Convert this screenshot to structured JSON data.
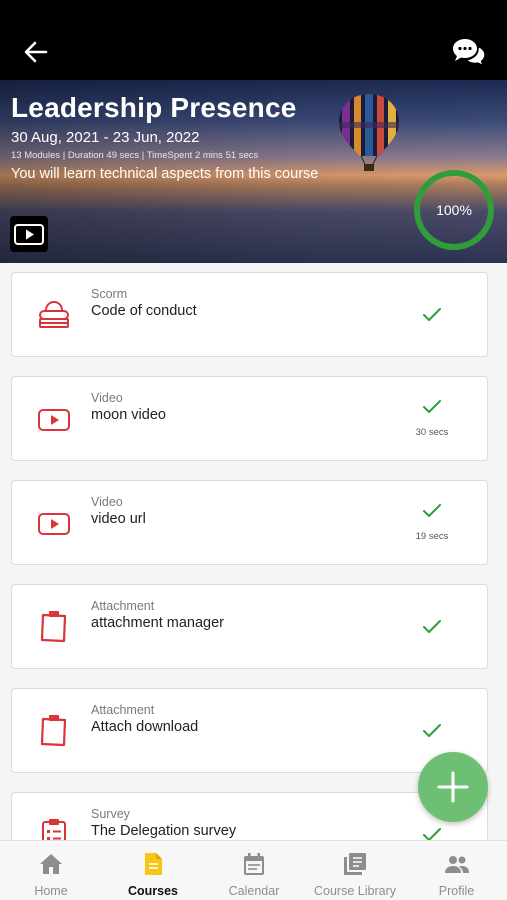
{
  "course": {
    "title": "Leadership Presence",
    "dates": "30 Aug, 2021 - 23 Jun, 2022",
    "meta": "13 Modules | Duration 49 secs | TimeSpent 2 mins 51 secs",
    "description": "You will learn technical aspects from this course",
    "progress": "100%",
    "progress_fraction": 1.0
  },
  "modules": [
    {
      "type": "Scorm",
      "title": "Code of conduct",
      "icon": "scorm-icon",
      "completed": true,
      "duration": ""
    },
    {
      "type": "Video",
      "title": "moon video",
      "icon": "video-icon",
      "completed": true,
      "duration": "30 secs"
    },
    {
      "type": "Video",
      "title": "video url",
      "icon": "video-icon",
      "completed": true,
      "duration": "19 secs"
    },
    {
      "type": "Attachment",
      "title": "attachment manager",
      "icon": "clipboard-icon",
      "completed": true,
      "duration": ""
    },
    {
      "type": "Attachment",
      "title": "Attach download",
      "icon": "clipboard-icon",
      "completed": true,
      "duration": ""
    },
    {
      "type": "Survey",
      "title": "The Delegation survey",
      "icon": "survey-icon",
      "completed": true,
      "duration": ""
    }
  ],
  "nav": {
    "items": [
      {
        "label": "Home",
        "icon": "home-icon"
      },
      {
        "label": "Courses",
        "icon": "courses-icon"
      },
      {
        "label": "Calendar",
        "icon": "calendar-icon"
      },
      {
        "label": "Course Library",
        "icon": "library-icon"
      },
      {
        "label": "Profile",
        "icon": "profile-icon"
      }
    ],
    "active": "Courses"
  },
  "colors": {
    "accent_green": "#2e9d3a",
    "icon_red": "#d9343a",
    "fab_green": "#6dbf73",
    "active_nav_yellow": "#f5c518"
  }
}
